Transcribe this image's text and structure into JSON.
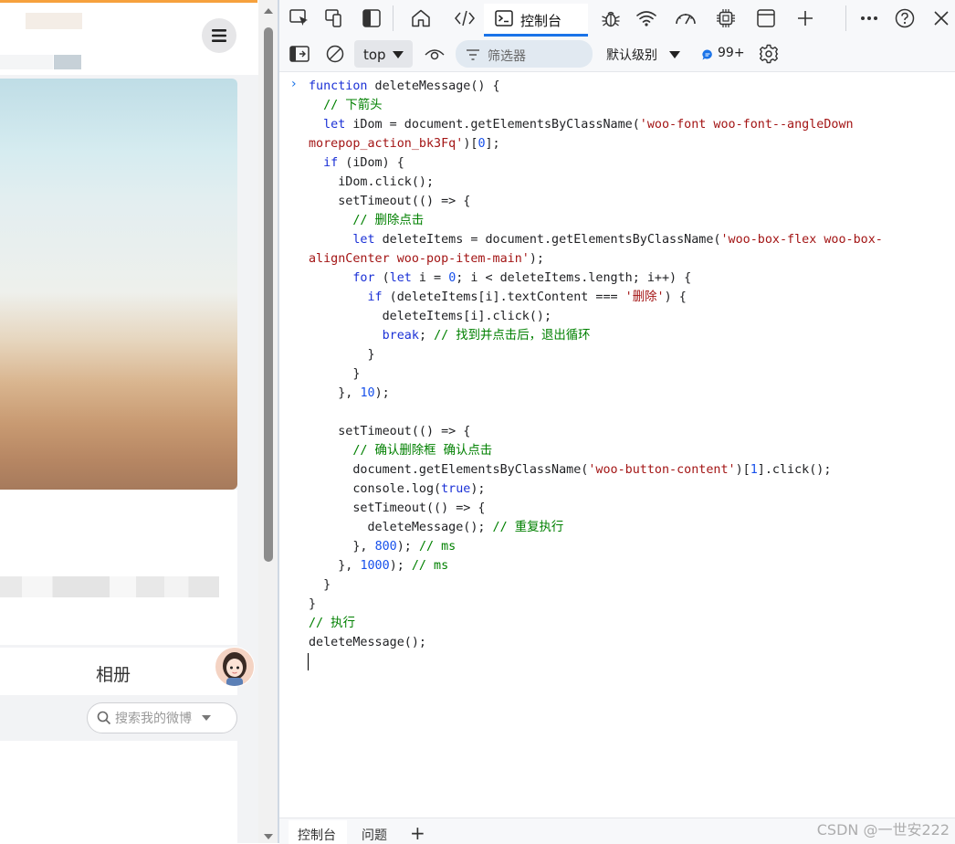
{
  "left_panel": {
    "tab_label": "相册",
    "search_placeholder": "搜索我的微博"
  },
  "devtools": {
    "tabs": {
      "console_label": "控制台"
    },
    "toolbar": {
      "context": "top",
      "filter_placeholder": "筛选器",
      "level": "默认级别",
      "issues_count": "99+"
    },
    "console": {
      "prompt_symbol": "›"
    },
    "bottom": {
      "tab_console": "控制台",
      "tab_issues": "问题",
      "add": "+"
    }
  },
  "watermark": "CSDN @一世安222",
  "colors": {
    "accent": "#1a73e8",
    "keyword": "#1b31d6",
    "string": "#a31515",
    "comment": "#008000",
    "number": "#1750eb"
  }
}
